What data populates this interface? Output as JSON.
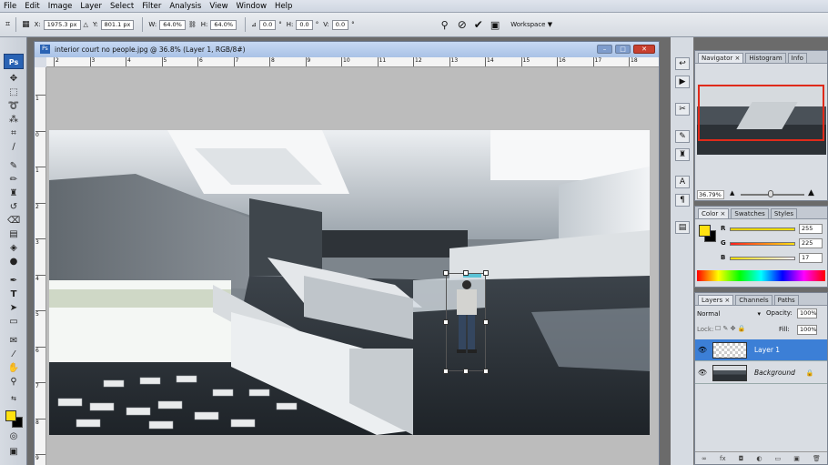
{
  "menu": [
    "File",
    "Edit",
    "Image",
    "Layer",
    "Select",
    "Filter",
    "Analysis",
    "View",
    "Window",
    "Help"
  ],
  "options": {
    "x_label": "X:",
    "x_value": "1975.3 px",
    "y_label": "Y:",
    "y_value": "801.1 px",
    "w_label": "W:",
    "w_value": "64.0%",
    "h_label": "H:",
    "h_value": "64.0%",
    "angle_value": "0.0",
    "angle_unit": "°",
    "hskew_label": "H:",
    "hskew_value": "0.0",
    "vskew_label": "V:",
    "vskew_value": "0.0",
    "workspace": "Workspace ▼"
  },
  "document": {
    "title": "interior court no people.jpg @ 36.8% (Layer 1, RGB/8#)",
    "icon": "Ps",
    "ruler_h": [
      "2",
      "3",
      "4",
      "5",
      "6",
      "7",
      "8",
      "9",
      "10",
      "11",
      "12",
      "13",
      "14",
      "15",
      "16",
      "17",
      "18"
    ],
    "ruler_v": [
      "1",
      "0",
      "1",
      "2",
      "3",
      "4",
      "5",
      "6",
      "7",
      "8",
      "9"
    ]
  },
  "tools": {
    "logo": "Ps"
  },
  "navigator": {
    "tabs": [
      "Navigator ×",
      "Histogram",
      "Info"
    ],
    "zoom": "36.79%"
  },
  "color": {
    "tabs": [
      "Color ×",
      "Swatches",
      "Styles"
    ],
    "r_label": "R",
    "r": "255",
    "g_label": "G",
    "g": "225",
    "b_label": "B",
    "b": "17",
    "r_fill": 1.0,
    "g_fill": 0.88,
    "b_fill": 0.07,
    "foreground": "#ffe111",
    "background": "#000000"
  },
  "layers": {
    "tabs": [
      "Layers ×",
      "Channels",
      "Paths"
    ],
    "blend": "Normal",
    "opacity_label": "Opacity:",
    "opacity": "100%",
    "lock_label": "Lock:",
    "fill_label": "Fill:",
    "fill": "100%",
    "items": [
      {
        "name": "Layer 1",
        "selected": true
      },
      {
        "name": "Background",
        "selected": false
      }
    ]
  }
}
